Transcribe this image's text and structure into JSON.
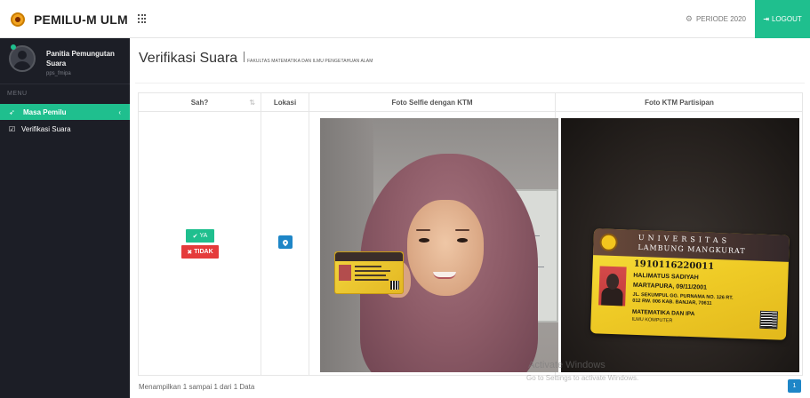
{
  "app": {
    "brand": "PEMILU-M ULM",
    "periode": "PERIODE 2020",
    "logout": "LOGOUT"
  },
  "sidebar": {
    "user_name": "Panitia Pemungutan Suara",
    "user_sub": "pps_fmipa",
    "menu_header": "MENU",
    "items": [
      {
        "label": "Masa Pemilu",
        "icon": "paper-plane-icon"
      },
      {
        "label": "Verifikasi Suara",
        "icon": "check-square-icon"
      }
    ]
  },
  "page": {
    "title": "Verifikasi Suara",
    "subtitle": "FAKULTAS MATEMATIKA DAN ILMU PENGETAHUAN ALAM"
  },
  "table": {
    "headers": [
      "Sah?",
      "Lokasi",
      "Foto Selfie dengan KTM",
      "Foto KTM Partisipan"
    ],
    "row": {
      "ya_label": "YA",
      "tidak_label": "TIDAK"
    }
  },
  "ktm": {
    "univ_line1": "UNIVERSITAS",
    "univ_line2": "LAMBUNG MANGKURAT",
    "nim": "1910116220011",
    "name": "HALIMATUS SADIYAH",
    "birth": "MARTAPURA, 09/11/2001",
    "address1": "JL. SEKUMPUL GG. PURNAMA NO. 126 RT.",
    "address2": "012 RW. 006 KAB. BANJAR, 70611",
    "faculty": "MATEMATIKA DAN IPA",
    "program": "ILMU KOMPUTER"
  },
  "footer": {
    "info": "Menampilkan 1 sampai 1 dari 1 Data",
    "page": "1"
  },
  "watermark": {
    "line1": "Activate Windows",
    "line2": "Go to Settings to activate Windows."
  },
  "colors": {
    "accent": "#1fbf8e",
    "danger": "#e53b3b",
    "info": "#1e86c7",
    "sidebar_bg": "#1c1e26"
  }
}
